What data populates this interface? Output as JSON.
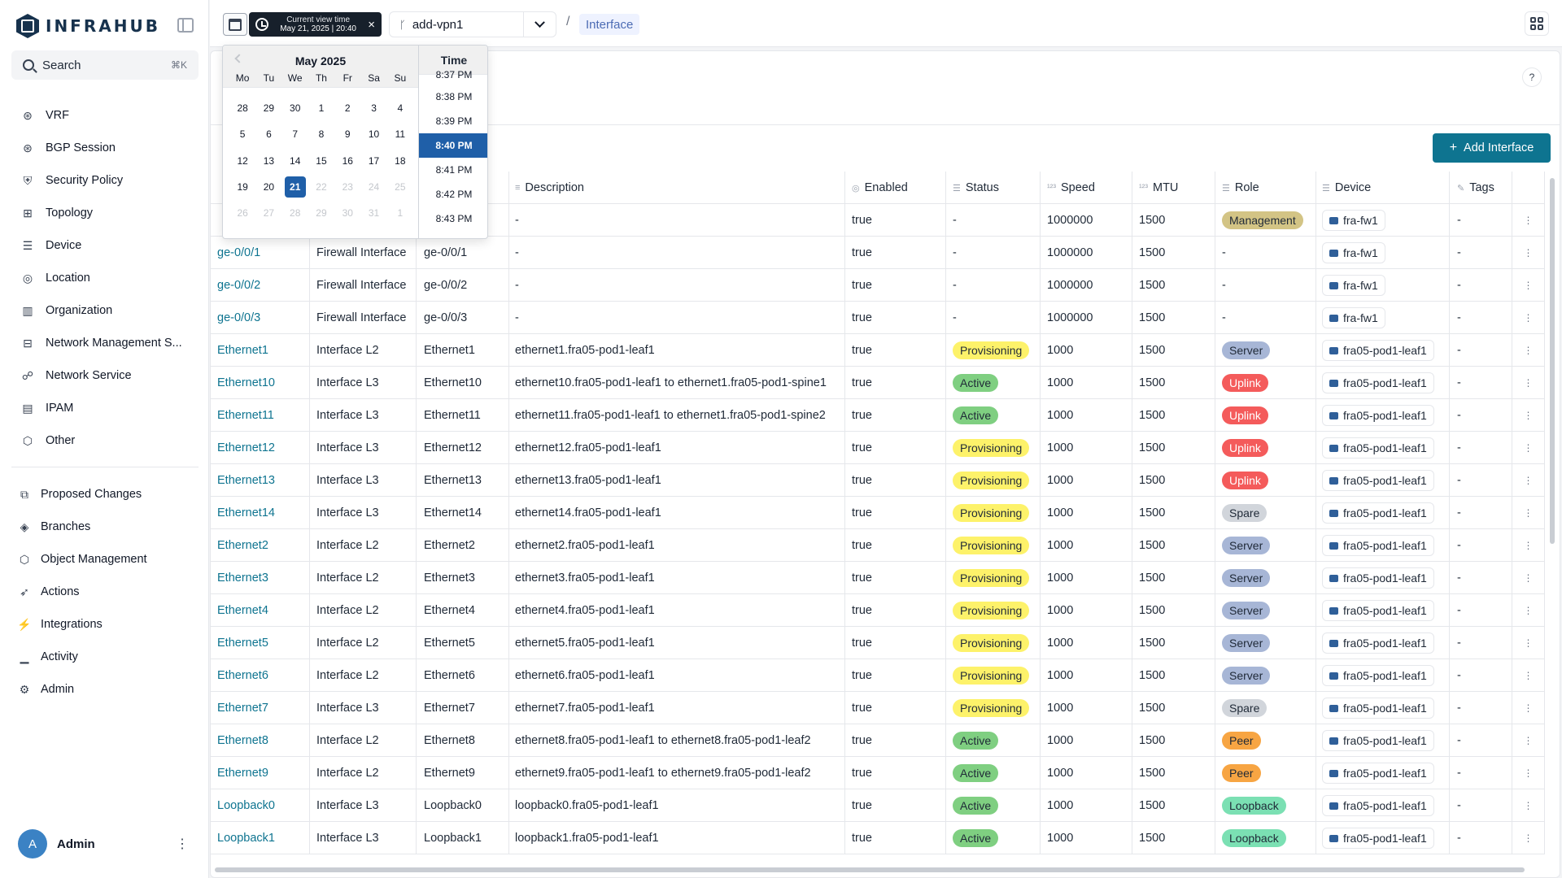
{
  "app": {
    "logo_text": "INFRAHUB"
  },
  "search": {
    "label": "Search",
    "shortcut": "⌘K"
  },
  "sidebar": {
    "menu": [
      {
        "label": "VRF",
        "icon": "vrf-icon"
      },
      {
        "label": "BGP Session",
        "icon": "bgp-icon"
      },
      {
        "label": "Security Policy",
        "icon": "shield-icon"
      },
      {
        "label": "Topology",
        "icon": "topology-icon"
      },
      {
        "label": "Device",
        "icon": "device-icon"
      },
      {
        "label": "Location",
        "icon": "location-icon"
      },
      {
        "label": "Organization",
        "icon": "building-icon"
      },
      {
        "label": "Network Management S...",
        "icon": "network-icon"
      },
      {
        "label": "Network Service",
        "icon": "service-icon"
      },
      {
        "label": "IPAM",
        "icon": "ipam-icon"
      },
      {
        "label": "Other",
        "icon": "cube-icon"
      }
    ],
    "secondary": [
      {
        "label": "Proposed Changes",
        "icon": "proposed-icon"
      },
      {
        "label": "Branches",
        "icon": "layers-icon"
      },
      {
        "label": "Object Management",
        "icon": "object-icon"
      },
      {
        "label": "Actions",
        "icon": "rocket-icon"
      },
      {
        "label": "Integrations",
        "icon": "plug-icon"
      },
      {
        "label": "Activity",
        "icon": "chart-icon"
      },
      {
        "label": "Admin",
        "icon": "gear-icon"
      }
    ],
    "user": {
      "initial": "A",
      "name": "Admin"
    }
  },
  "topbar": {
    "time_chip_title": "Current view time",
    "time_chip_value": "May 21, 2025 | 20:40",
    "branch": "add-vpn1",
    "breadcrumb": "Interface"
  },
  "main": {
    "add_button": "Add Interface",
    "help": "?"
  },
  "datepicker": {
    "month": "May 2025",
    "dows": [
      "Mo",
      "Tu",
      "We",
      "Th",
      "Fr",
      "Sa",
      "Su"
    ],
    "weeks": [
      [
        {
          "d": "28"
        },
        {
          "d": "29"
        },
        {
          "d": "30"
        },
        {
          "d": "1"
        },
        {
          "d": "2"
        },
        {
          "d": "3"
        },
        {
          "d": "4"
        }
      ],
      [
        {
          "d": "5"
        },
        {
          "d": "6"
        },
        {
          "d": "7"
        },
        {
          "d": "8"
        },
        {
          "d": "9"
        },
        {
          "d": "10"
        },
        {
          "d": "11"
        }
      ],
      [
        {
          "d": "12"
        },
        {
          "d": "13"
        },
        {
          "d": "14"
        },
        {
          "d": "15"
        },
        {
          "d": "16"
        },
        {
          "d": "17"
        },
        {
          "d": "18"
        }
      ],
      [
        {
          "d": "19"
        },
        {
          "d": "20"
        },
        {
          "d": "21",
          "sel": true
        },
        {
          "d": "22",
          "out": true
        },
        {
          "d": "23",
          "out": true
        },
        {
          "d": "24",
          "out": true
        },
        {
          "d": "25",
          "out": true
        }
      ],
      [
        {
          "d": "26",
          "out": true
        },
        {
          "d": "27",
          "out": true
        },
        {
          "d": "28",
          "out": true
        },
        {
          "d": "29",
          "out": true
        },
        {
          "d": "30",
          "out": true
        },
        {
          "d": "31",
          "out": true
        },
        {
          "d": "1",
          "out": true
        }
      ]
    ],
    "time_label": "Time",
    "times": [
      "8:37 PM",
      "8:38 PM",
      "8:39 PM",
      "8:40 PM",
      "8:41 PM",
      "8:42 PM",
      "8:43 PM"
    ],
    "selected_time": "8:40 PM"
  },
  "table": {
    "columns": [
      "",
      "",
      "",
      "Description",
      "Enabled",
      "Status",
      "Speed",
      "MTU",
      "Role",
      "Device",
      "Tags",
      ""
    ],
    "rows": [
      {
        "name": "",
        "kind": "",
        "label": "",
        "desc": "-",
        "enabled": "true",
        "status": "-",
        "speed": "1000000",
        "mtu": "1500",
        "role": "Management",
        "device": "fra-fw1",
        "tags": "-"
      },
      {
        "name": "ge-0/0/1",
        "kind": "Firewall Interface",
        "label": "ge-0/0/1",
        "desc": "-",
        "enabled": "true",
        "status": "-",
        "speed": "1000000",
        "mtu": "1500",
        "role": "-",
        "device": "fra-fw1",
        "tags": "-"
      },
      {
        "name": "ge-0/0/2",
        "kind": "Firewall Interface",
        "label": "ge-0/0/2",
        "desc": "-",
        "enabled": "true",
        "status": "-",
        "speed": "1000000",
        "mtu": "1500",
        "role": "-",
        "device": "fra-fw1",
        "tags": "-"
      },
      {
        "name": "ge-0/0/3",
        "kind": "Firewall Interface",
        "label": "ge-0/0/3",
        "desc": "-",
        "enabled": "true",
        "status": "-",
        "speed": "1000000",
        "mtu": "1500",
        "role": "-",
        "device": "fra-fw1",
        "tags": "-"
      },
      {
        "name": "Ethernet1",
        "kind": "Interface L2",
        "label": "Ethernet1",
        "desc": "ethernet1.fra05-pod1-leaf1",
        "enabled": "true",
        "status": "Provisioning",
        "speed": "1000",
        "mtu": "1500",
        "role": "Server",
        "device": "fra05-pod1-leaf1",
        "tags": "-"
      },
      {
        "name": "Ethernet10",
        "kind": "Interface L3",
        "label": "Ethernet10",
        "desc": "ethernet10.fra05-pod1-leaf1 to ethernet1.fra05-pod1-spine1",
        "enabled": "true",
        "status": "Active",
        "speed": "1000",
        "mtu": "1500",
        "role": "Uplink",
        "device": "fra05-pod1-leaf1",
        "tags": "-"
      },
      {
        "name": "Ethernet11",
        "kind": "Interface L3",
        "label": "Ethernet11",
        "desc": "ethernet11.fra05-pod1-leaf1 to ethernet1.fra05-pod1-spine2",
        "enabled": "true",
        "status": "Active",
        "speed": "1000",
        "mtu": "1500",
        "role": "Uplink",
        "device": "fra05-pod1-leaf1",
        "tags": "-"
      },
      {
        "name": "Ethernet12",
        "kind": "Interface L3",
        "label": "Ethernet12",
        "desc": "ethernet12.fra05-pod1-leaf1",
        "enabled": "true",
        "status": "Provisioning",
        "speed": "1000",
        "mtu": "1500",
        "role": "Uplink",
        "device": "fra05-pod1-leaf1",
        "tags": "-"
      },
      {
        "name": "Ethernet13",
        "kind": "Interface L3",
        "label": "Ethernet13",
        "desc": "ethernet13.fra05-pod1-leaf1",
        "enabled": "true",
        "status": "Provisioning",
        "speed": "1000",
        "mtu": "1500",
        "role": "Uplink",
        "device": "fra05-pod1-leaf1",
        "tags": "-"
      },
      {
        "name": "Ethernet14",
        "kind": "Interface L3",
        "label": "Ethernet14",
        "desc": "ethernet14.fra05-pod1-leaf1",
        "enabled": "true",
        "status": "Provisioning",
        "speed": "1000",
        "mtu": "1500",
        "role": "Spare",
        "device": "fra05-pod1-leaf1",
        "tags": "-"
      },
      {
        "name": "Ethernet2",
        "kind": "Interface L2",
        "label": "Ethernet2",
        "desc": "ethernet2.fra05-pod1-leaf1",
        "enabled": "true",
        "status": "Provisioning",
        "speed": "1000",
        "mtu": "1500",
        "role": "Server",
        "device": "fra05-pod1-leaf1",
        "tags": "-"
      },
      {
        "name": "Ethernet3",
        "kind": "Interface L2",
        "label": "Ethernet3",
        "desc": "ethernet3.fra05-pod1-leaf1",
        "enabled": "true",
        "status": "Provisioning",
        "speed": "1000",
        "mtu": "1500",
        "role": "Server",
        "device": "fra05-pod1-leaf1",
        "tags": "-"
      },
      {
        "name": "Ethernet4",
        "kind": "Interface L2",
        "label": "Ethernet4",
        "desc": "ethernet4.fra05-pod1-leaf1",
        "enabled": "true",
        "status": "Provisioning",
        "speed": "1000",
        "mtu": "1500",
        "role": "Server",
        "device": "fra05-pod1-leaf1",
        "tags": "-"
      },
      {
        "name": "Ethernet5",
        "kind": "Interface L2",
        "label": "Ethernet5",
        "desc": "ethernet5.fra05-pod1-leaf1",
        "enabled": "true",
        "status": "Provisioning",
        "speed": "1000",
        "mtu": "1500",
        "role": "Server",
        "device": "fra05-pod1-leaf1",
        "tags": "-"
      },
      {
        "name": "Ethernet6",
        "kind": "Interface L2",
        "label": "Ethernet6",
        "desc": "ethernet6.fra05-pod1-leaf1",
        "enabled": "true",
        "status": "Provisioning",
        "speed": "1000",
        "mtu": "1500",
        "role": "Server",
        "device": "fra05-pod1-leaf1",
        "tags": "-"
      },
      {
        "name": "Ethernet7",
        "kind": "Interface L3",
        "label": "Ethernet7",
        "desc": "ethernet7.fra05-pod1-leaf1",
        "enabled": "true",
        "status": "Provisioning",
        "speed": "1000",
        "mtu": "1500",
        "role": "Spare",
        "device": "fra05-pod1-leaf1",
        "tags": "-"
      },
      {
        "name": "Ethernet8",
        "kind": "Interface L2",
        "label": "Ethernet8",
        "desc": "ethernet8.fra05-pod1-leaf1 to ethernet8.fra05-pod1-leaf2",
        "enabled": "true",
        "status": "Active",
        "speed": "1000",
        "mtu": "1500",
        "role": "Peer",
        "device": "fra05-pod1-leaf1",
        "tags": "-"
      },
      {
        "name": "Ethernet9",
        "kind": "Interface L2",
        "label": "Ethernet9",
        "desc": "ethernet9.fra05-pod1-leaf1 to ethernet9.fra05-pod1-leaf2",
        "enabled": "true",
        "status": "Active",
        "speed": "1000",
        "mtu": "1500",
        "role": "Peer",
        "device": "fra05-pod1-leaf1",
        "tags": "-"
      },
      {
        "name": "Loopback0",
        "kind": "Interface L3",
        "label": "Loopback0",
        "desc": "loopback0.fra05-pod1-leaf1",
        "enabled": "true",
        "status": "Active",
        "speed": "1000",
        "mtu": "1500",
        "role": "Loopback",
        "device": "fra05-pod1-leaf1",
        "tags": "-"
      },
      {
        "name": "Loopback1",
        "kind": "Interface L3",
        "label": "Loopback1",
        "desc": "loopback1.fra05-pod1-leaf1",
        "enabled": "true",
        "status": "Active",
        "speed": "1000",
        "mtu": "1500",
        "role": "Loopback",
        "device": "fra05-pod1-leaf1",
        "tags": "-"
      }
    ]
  }
}
